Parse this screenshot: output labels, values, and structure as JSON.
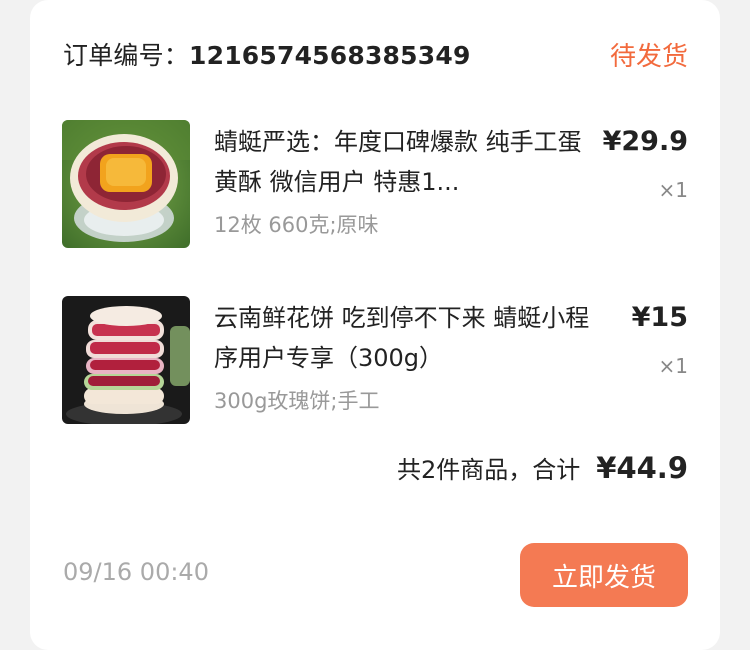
{
  "order": {
    "number_label": "订单编号：",
    "number": "1216574568385349",
    "status": "待发货"
  },
  "items": [
    {
      "title": "蜻蜓严选：年度口碑爆款 纯手工蛋黄酥 微信用户 特惠1...",
      "spec": "12枚 660克;原味",
      "price": "¥29.9",
      "qty": "×1",
      "image": "egg-yolk-pastry-photo"
    },
    {
      "title": "云南鲜花饼 吃到停不下来 蜻蜓小程序用户专享（300g）",
      "spec": "300g玫瑰饼;手工",
      "price": "¥15",
      "qty": "×1",
      "image": "flower-cake-stack-photo"
    }
  ],
  "summary": {
    "label": "共2件商品，合计",
    "total": "¥44.9"
  },
  "footer": {
    "time": "09/16 00:40",
    "ship_button": "立即发货"
  },
  "colors": {
    "status": "#f26a3d",
    "button_bg": "#f47a53",
    "card_bg": "#ffffff",
    "page_bg": "#f2f2f2"
  }
}
